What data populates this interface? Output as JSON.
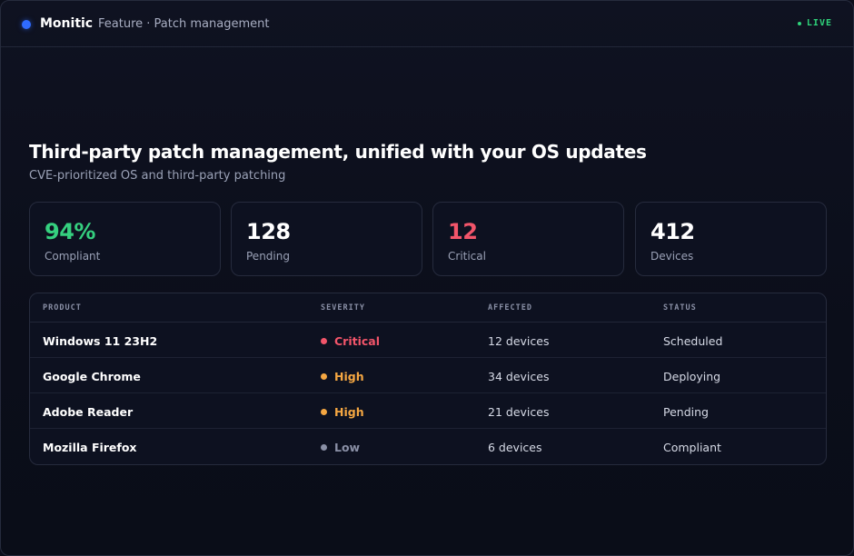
{
  "app": {
    "name": "Monitic",
    "breadcrumb": "Feature · Patch management",
    "live_label": "LIVE"
  },
  "hero": {
    "title": "Third-party patch management, unified with your OS updates",
    "subtitle": "CVE-prioritized OS and third-party patching"
  },
  "stats": [
    {
      "value": "94%",
      "label": "Compliant",
      "color": "#35d07f"
    },
    {
      "value": "128",
      "label": "Pending",
      "color": "#ffffff"
    },
    {
      "value": "12",
      "label": "Critical",
      "color": "#f2556a"
    },
    {
      "value": "412",
      "label": "Devices",
      "color": "#ffffff"
    }
  ],
  "table": {
    "headers": {
      "product": "PRODUCT",
      "severity": "SEVERITY",
      "affected": "AFFECTED",
      "status": "STATUS"
    },
    "rows": [
      {
        "product": "Windows 11 23H2",
        "severity": "Critical",
        "severity_color": "#f2556a",
        "affected": "12 devices",
        "status": "Scheduled"
      },
      {
        "product": "Google Chrome",
        "severity": "High",
        "severity_color": "#f5a742",
        "affected": "34 devices",
        "status": "Deploying"
      },
      {
        "product": "Adobe Reader",
        "severity": "High",
        "severity_color": "#f5a742",
        "affected": "21 devices",
        "status": "Pending"
      },
      {
        "product": "Mozilla Firefox",
        "severity": "Low",
        "severity_color": "#8a90a6",
        "affected": "6 devices",
        "status": "Compliant"
      }
    ]
  },
  "colors": {
    "accent": "#2f6bff",
    "live": "#2fd37a",
    "background": "#0b0e1a"
  }
}
